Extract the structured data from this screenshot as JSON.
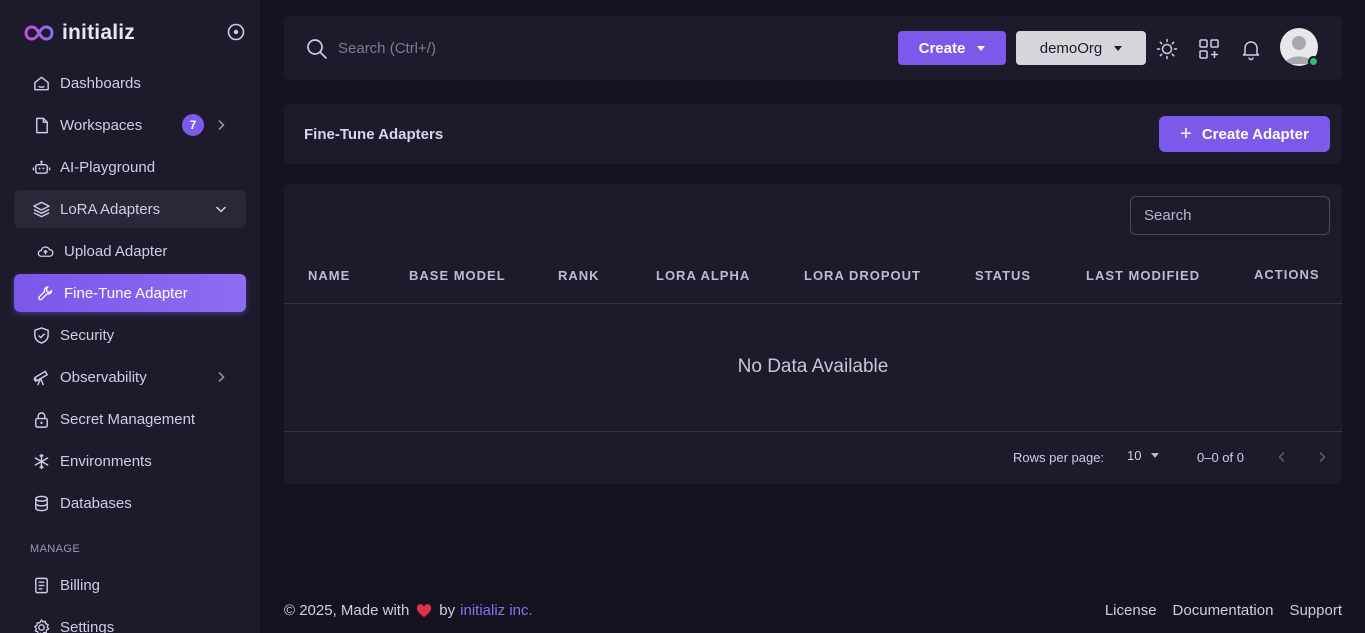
{
  "brand": {
    "name": "initializ"
  },
  "sidebar": {
    "items": [
      {
        "label": "Dashboards"
      },
      {
        "label": "Workspaces",
        "badge": "7"
      },
      {
        "label": "AI-Playground"
      },
      {
        "label": "LoRA Adapters"
      },
      {
        "label": "Upload Adapter"
      },
      {
        "label": "Fine-Tune Adapter"
      },
      {
        "label": "Security"
      },
      {
        "label": "Observability"
      },
      {
        "label": "Secret Management"
      },
      {
        "label": "Environments"
      },
      {
        "label": "Databases"
      },
      {
        "label": "Billing"
      },
      {
        "label": "Settings"
      }
    ],
    "section_manage": "MANAGE",
    "active_color": "#7c5ae9"
  },
  "topbar": {
    "search_placeholder": "Search (Ctrl+/)",
    "create_label": "Create",
    "org_label": "demoOrg",
    "status_color": "#2bc26a"
  },
  "header": {
    "title": "Fine-Tune Adapters",
    "create_adapter_label": "Create Adapter"
  },
  "table": {
    "search_placeholder": "Search",
    "columns": [
      "NAME",
      "BASE MODEL",
      "RANK",
      "LORA ALPHA",
      "LORA DROPOUT",
      "STATUS",
      "LAST MODIFIED",
      "ACTIONS"
    ],
    "empty_text": "No Data Available",
    "rows_per_page_label": "Rows per page:",
    "rows_per_page_value": "10",
    "range": "0–0 of 0"
  },
  "footer": {
    "copyright": "© 2025, Made with",
    "by": "by",
    "company": "initializ inc.",
    "links": [
      "License",
      "Documentation",
      "Support"
    ]
  }
}
